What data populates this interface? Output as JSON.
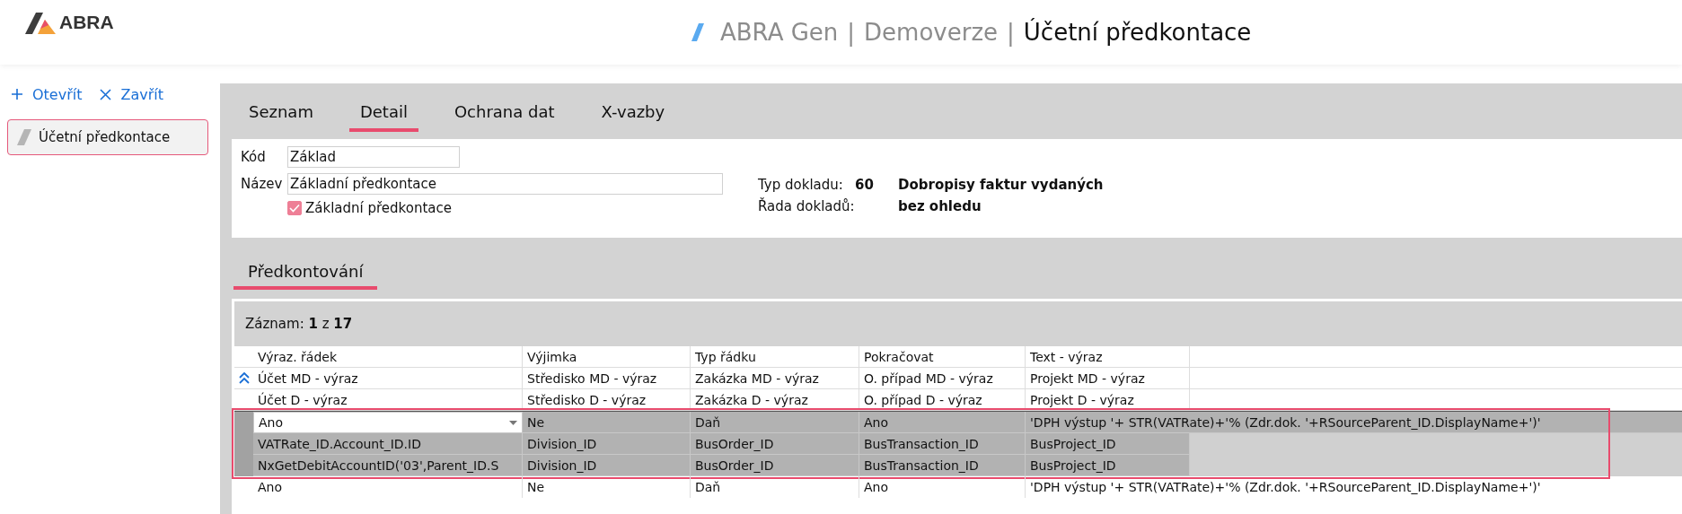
{
  "header": {
    "logo": "ABRA",
    "breadcrumb": [
      "ABRA Gen",
      "Demoverze",
      "Účetní předkontace"
    ],
    "separator": "|"
  },
  "sidebar": {
    "actions": [
      {
        "kind": "open",
        "label": "Otevřít"
      },
      {
        "kind": "close",
        "label": "Zavřít"
      }
    ],
    "open_documents": [
      {
        "label": "Účetní předkontace",
        "selected": true
      }
    ]
  },
  "tabs": [
    {
      "label": "Seznam",
      "selected": false
    },
    {
      "label": "Detail",
      "selected": true
    },
    {
      "label": "Ochrana dat",
      "selected": false
    },
    {
      "label": "X-vazby",
      "selected": false
    }
  ],
  "form": {
    "code": {
      "label": "Kód",
      "value": "Základ"
    },
    "name": {
      "label": "Název",
      "value": "Základní předkontace"
    },
    "basic": {
      "label": "Základní předkontace",
      "checked": true
    },
    "doc_type": {
      "label": "Typ dokladu:",
      "number": "60",
      "name": "Dobropisy faktur vydaných"
    },
    "doc_series": {
      "label": "Řada dokladů:",
      "value": "bez ohledu"
    }
  },
  "subtabs": [
    {
      "label": "Předkontování",
      "selected": true
    }
  ],
  "table": {
    "record_counter": "Záznam: **1** z **17**",
    "header_expanded": true,
    "header_rows": [
      [
        "Výraz. řádek",
        "Výjimka",
        "Typ řádku",
        "Pokračovat",
        "Text - výraz"
      ],
      [
        "Účet MD - výraz",
        "Středisko MD - výraz",
        "Zakázka MD - výraz",
        "O. případ MD - výraz",
        "Projekt MD - výraz"
      ],
      [
        "Účet D - výraz",
        "Středisko D - výraz",
        "Zakázka D - výraz",
        "O. případ D - výraz",
        "Projekt D - výraz"
      ]
    ],
    "records": [
      {
        "selected": true,
        "lines": [
          [
            "Ano",
            "Ne",
            "Daň",
            "Ano",
            "'DPH výstup '+ STR(VATRate)+'% (Zdr.dok. '+RSourceParent_ID.DisplayName+')'"
          ],
          [
            "VATRate_ID.Account_ID.ID",
            "Division_ID",
            "BusOrder_ID",
            "BusTransaction_ID",
            "BusProject_ID"
          ],
          [
            "NxGetDebitAccountID('03',Parent_ID.S",
            "Division_ID",
            "BusOrder_ID",
            "BusTransaction_ID",
            "BusProject_ID"
          ]
        ]
      },
      {
        "selected": false,
        "lines": [
          [
            "Ano",
            "Ne",
            "Daň",
            "Ano",
            "'DPH výstup '+ STR(VATRate)+'% (Zdr.dok. '+RSourceParent_ID.DisplayName+')'"
          ]
        ]
      }
    ]
  }
}
